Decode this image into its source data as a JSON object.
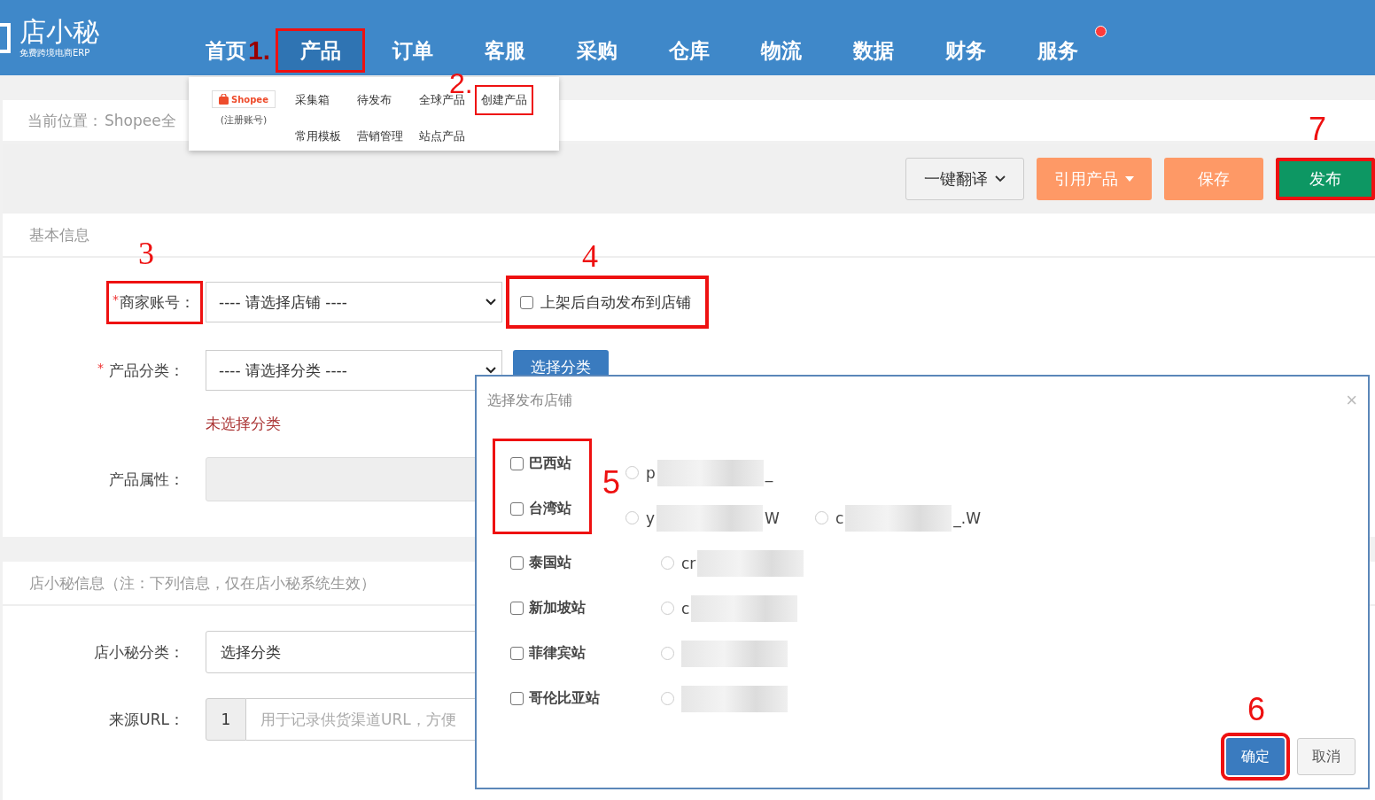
{
  "logo": {
    "name": "店小秘",
    "tagline": "免费跨境电商ERP"
  },
  "nav": [
    {
      "label": "首页",
      "selected": false,
      "annotation": "1."
    },
    {
      "label": "产品",
      "selected": true,
      "highlighted": true
    },
    {
      "label": "订单",
      "selected": false
    },
    {
      "label": "客服",
      "selected": false
    },
    {
      "label": "采购",
      "selected": false
    },
    {
      "label": "仓库",
      "selected": false
    },
    {
      "label": "物流",
      "selected": false
    },
    {
      "label": "数据",
      "selected": false
    },
    {
      "label": "财务",
      "selected": false
    },
    {
      "label": "服务",
      "selected": false,
      "notification": true
    }
  ],
  "menu": {
    "brand": "Shopee",
    "brand_note": "(注册账号)",
    "links": [
      {
        "label": "采集箱"
      },
      {
        "label": "待发布"
      },
      {
        "label": "全球产品"
      },
      {
        "label": "创建产品",
        "highlighted": true,
        "annotation": "2."
      },
      {
        "label": "常用模板"
      },
      {
        "label": "营销管理"
      },
      {
        "label": "站点产品"
      }
    ]
  },
  "breadcrumb": {
    "label": "当前位置：",
    "path": "Shopee全"
  },
  "toolbar": [
    {
      "kind": "dropdown",
      "label": "一键翻译",
      "color": "#f2f2f2"
    },
    {
      "kind": "split",
      "label": "引用产品",
      "color": "#fe9966"
    },
    {
      "kind": "plain",
      "label": "保存",
      "color": "#fe9966"
    },
    {
      "kind": "plain",
      "label": "发布",
      "color": "#0d9763",
      "highlighted": true,
      "annotation": "7"
    }
  ],
  "basic": {
    "title": "基本信息",
    "account": {
      "label": "商家账号：",
      "required_mark": "*",
      "highlighted": true,
      "annotation": "3",
      "value": "---- 请选择店铺 ----"
    },
    "auto_publish": {
      "label": "上架后自动发布到店铺",
      "checked": false,
      "highlighted": true,
      "annotation": "4"
    },
    "category": {
      "label": "产品分类：",
      "required_mark": "*",
      "value": "---- 请选择分类 ----",
      "button": "选择分类",
      "error": "未选择分类"
    },
    "attributes": {
      "label": "产品属性："
    }
  },
  "dxm": {
    "title": "店小秘信息（注：下列信息，仅在店小秘系统生效）",
    "category": {
      "label": "店小秘分类：",
      "value": "选择分类"
    },
    "source": {
      "label": "来源URL：",
      "addon": "1",
      "placeholder": "用于记录供货渠道URL，方便"
    }
  },
  "dialog": {
    "title": "选择发布店铺",
    "close": "×",
    "sites_annotation": "5",
    "sites": [
      {
        "label": "巴西站",
        "checked": false,
        "highlighted": true,
        "shops": [
          {
            "selected": false,
            "prefix": "p",
            "suffix": "_"
          }
        ]
      },
      {
        "label": "台湾站",
        "checked": false,
        "highlighted": true,
        "shops": [
          {
            "selected": false,
            "prefix": "y",
            "suffix": "W"
          },
          {
            "selected": false,
            "prefix": "c",
            "suffix": "_.W"
          }
        ]
      },
      {
        "label": "泰国站",
        "checked": false,
        "shops": [
          {
            "selected": false,
            "prefix": "cr"
          }
        ]
      },
      {
        "label": "新加坡站",
        "checked": false,
        "shops": [
          {
            "selected": false,
            "prefix": "c"
          }
        ]
      },
      {
        "label": "菲律宾站",
        "checked": false,
        "shops": [
          {
            "selected": false
          }
        ]
      },
      {
        "label": "哥伦比亚站",
        "checked": false,
        "shops": [
          {
            "selected": false
          }
        ]
      }
    ],
    "buttons": [
      {
        "kind": "primary",
        "label": "确定",
        "highlighted": true,
        "annotation": "6"
      },
      {
        "kind": "default",
        "label": "取消"
      }
    ]
  }
}
